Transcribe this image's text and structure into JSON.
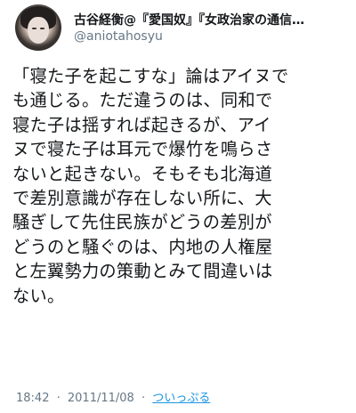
{
  "author": {
    "display_name": "古谷経衡@『愛国奴』『女政治家の通信…",
    "handle": "@aniotahosyu"
  },
  "tweet": {
    "lines": [
      "「寝た子を起こすな」論はアイヌで",
      "も通じる。ただ違うのは、同和で",
      "寝た子は揺すれば起きるが、アイ",
      "ヌで寝た子は耳元で爆竹を鳴らさ",
      "ないと起きない。そもそも北海道",
      "で差別意識が存在しない所に、大",
      "騒ぎして先住民族がどうの差別が",
      "どうのと騒ぐのは、内地の人権屋",
      "と左翼勢力の策動とみて間違いは",
      "ない。"
    ],
    "time": "18:42",
    "date": "2011/11/08",
    "separator": "·",
    "client": "ついっぷる"
  },
  "colors": {
    "text": "#14171a",
    "muted": "#657786",
    "link": "#1b95e0"
  }
}
